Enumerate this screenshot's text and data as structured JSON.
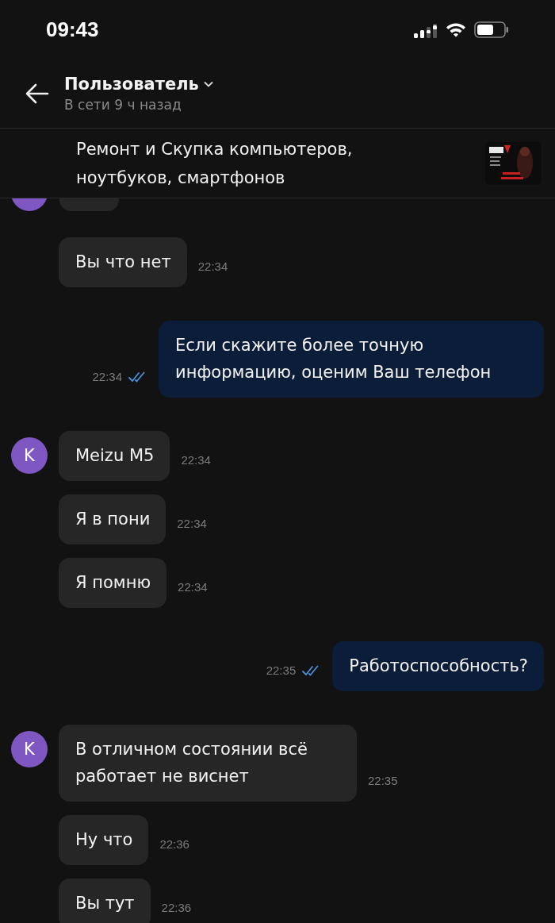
{
  "status_bar": {
    "time": "09:43"
  },
  "header": {
    "name": "Пользователь",
    "status": "В сети 9 ч назад"
  },
  "pinned": {
    "title": "Ремонт и Скупка компьютеров, ноутбуков, смартфонов"
  },
  "messages": [
    {
      "kind": "incoming",
      "text": "Вы что нет",
      "time": "22:34"
    },
    {
      "kind": "outgoing",
      "text": "Если скажите более точную информацию, оценим Ваш телефон",
      "time": "22:34",
      "read": true
    },
    {
      "kind": "incoming",
      "avatar": "K",
      "text": "Meizu M5",
      "time": "22:34"
    },
    {
      "kind": "incoming",
      "text": "Я в пони",
      "time": "22:34"
    },
    {
      "kind": "incoming",
      "text": "Я помню",
      "time": "22:34"
    },
    {
      "kind": "outgoing",
      "text": "Работоспособность?",
      "time": "22:35",
      "read": true
    },
    {
      "kind": "incoming",
      "avatar": "K",
      "text": "В отличном состоянии всё работает не виснет",
      "time": "22:35"
    },
    {
      "kind": "incoming",
      "text": "Ну что",
      "time": "22:36"
    },
    {
      "kind": "incoming",
      "text": "Вы тут",
      "time": "22:36"
    }
  ]
}
